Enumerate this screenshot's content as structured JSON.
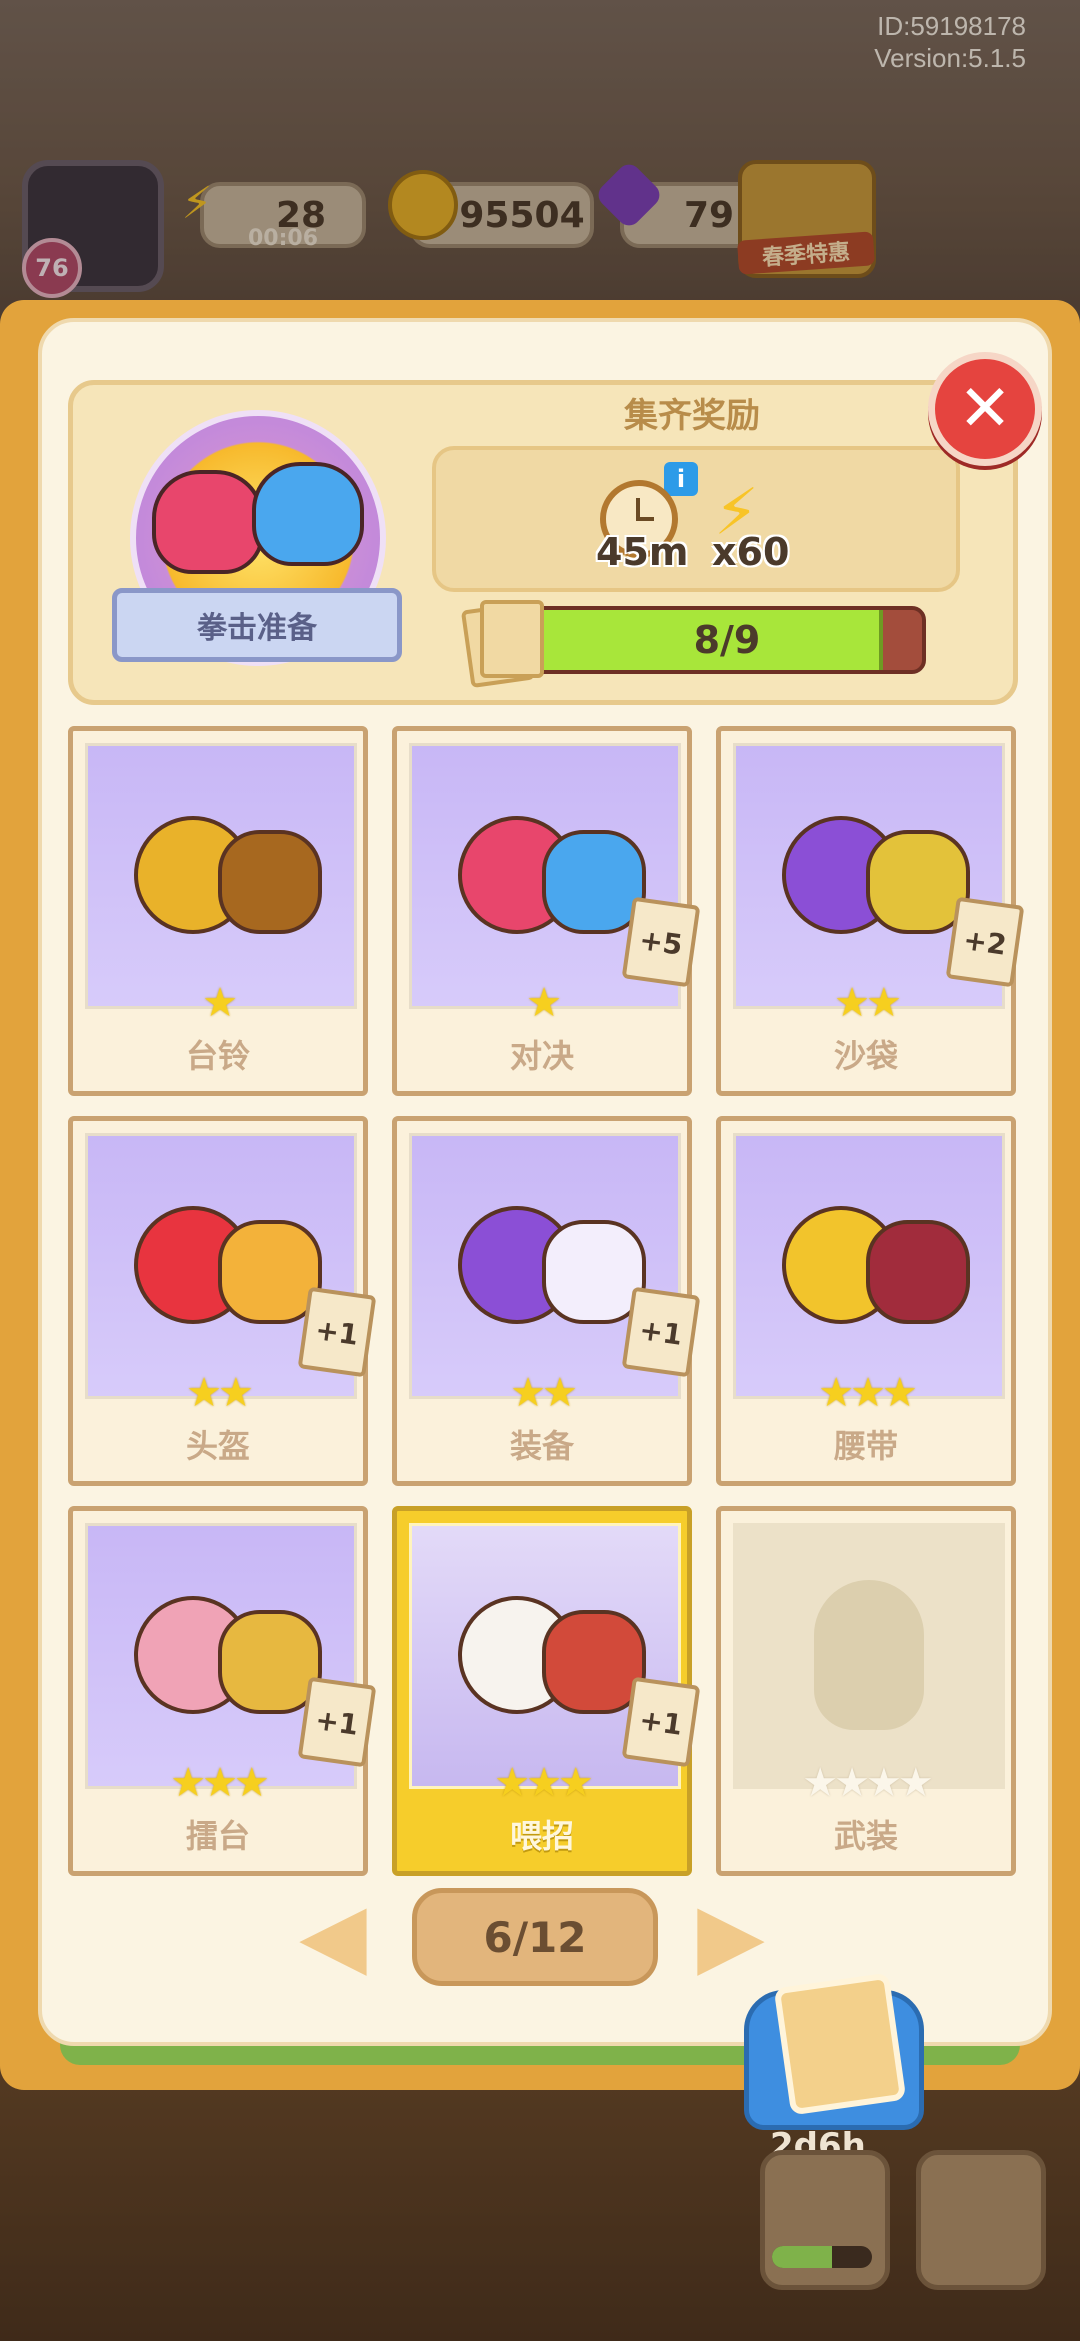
{
  "meta": {
    "id_text": "ID:59198178",
    "version_text": "Version:5.1.5"
  },
  "hud": {
    "level": "76",
    "energy": "28",
    "energy_timer": "00:06",
    "coins": "95504",
    "gems": "79",
    "event_label": "春季特惠"
  },
  "album": {
    "name": "拳击准备"
  },
  "reward": {
    "title": "集齐奖励",
    "time_value": "45m",
    "energy_value": "x60",
    "info": "i"
  },
  "progress": {
    "collected": 8,
    "total": 9,
    "text": "8/9"
  },
  "close_label": "✕",
  "cards": [
    {
      "name": "台铃",
      "stars": 1,
      "max_stars": 1,
      "dup": ""
    },
    {
      "name": "对决",
      "stars": 1,
      "max_stars": 1,
      "dup": "+5"
    },
    {
      "name": "沙袋",
      "stars": 2,
      "max_stars": 2,
      "dup": "+2"
    },
    {
      "name": "头盔",
      "stars": 2,
      "max_stars": 2,
      "dup": "+1"
    },
    {
      "name": "装备",
      "stars": 2,
      "max_stars": 2,
      "dup": "+1"
    },
    {
      "name": "腰带",
      "stars": 3,
      "max_stars": 3,
      "dup": ""
    },
    {
      "name": "擂台",
      "stars": 3,
      "max_stars": 3,
      "dup": "+1"
    },
    {
      "name": "喂招",
      "stars": 3,
      "max_stars": 3,
      "dup": "+1",
      "highlight": true
    },
    {
      "name": "武装",
      "stars": 0,
      "max_stars": 4,
      "dup": "",
      "locked": true
    }
  ],
  "pager": {
    "label": "6/12",
    "prev": "◀",
    "next": "▶"
  },
  "album_button": {
    "timer": "2d6h"
  },
  "colors": {
    "panel": "#fbf4e2",
    "accent": "#e2a33c",
    "progress_fill": "#a8e63a",
    "close": "#e5443f"
  }
}
